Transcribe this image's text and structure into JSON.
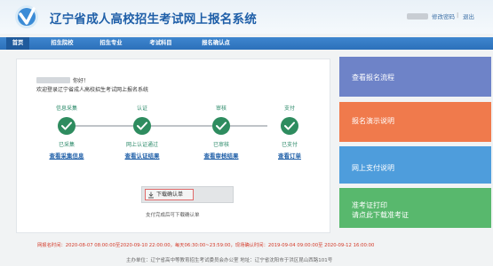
{
  "header": {
    "title": "辽宁省成人高校招生考试网上报名系统",
    "change_password": "修改密码",
    "separator": "|",
    "logout": "退出"
  },
  "nav": {
    "items": [
      {
        "label": "首页",
        "active": true
      },
      {
        "label": "招生院校",
        "active": false
      },
      {
        "label": "招生专业",
        "active": false
      },
      {
        "label": "考试科目",
        "active": false
      },
      {
        "label": "报名确认点",
        "active": false
      }
    ]
  },
  "main": {
    "greeting": "你好！",
    "welcome": "欢迎登录辽宁省成人高校招生考试网上报名系统",
    "steps": [
      {
        "title": "信息采集",
        "status": "已采集",
        "link": "查看采集信息"
      },
      {
        "title": "认证",
        "status": "网上认证通过",
        "link": "查看认证结果"
      },
      {
        "title": "审核",
        "status": "已审核",
        "link": "查看审核结果"
      },
      {
        "title": "支付",
        "status": "已支付",
        "link": "查看订单"
      }
    ],
    "download_label": "下载确认单",
    "download_hint": "支付完成后可下载确认单"
  },
  "side_cards": [
    {
      "lines": [
        "查看报名流程"
      ],
      "color": "#6e83c8"
    },
    {
      "lines": [
        "报名演示说明"
      ],
      "color": "#f07a4c"
    },
    {
      "lines": [
        "网上支付说明"
      ],
      "color": "#4e9ddc"
    },
    {
      "lines": [
        "准考证打印",
        "请点此下载准考证"
      ],
      "color": "#58b86d"
    }
  ],
  "footer": {
    "dates": "网报名时间：2020-08-07 08:00:00至2020-09-10 22:00:00，每天06:30:00~23:59:00，现场确认时间：2019-09-04 09:00:00至 2020-09-12 16:00:00",
    "info": "主办单位：辽宁省高中等教育招生考试委员会办公室       地址：辽宁省沈阳市于洪区昆山西路101号"
  },
  "colors": {
    "brand": "#1f5fa8",
    "nav": "#2c70ba",
    "step_green": "#2e8c5f",
    "footer_red": "#d43b2a"
  }
}
